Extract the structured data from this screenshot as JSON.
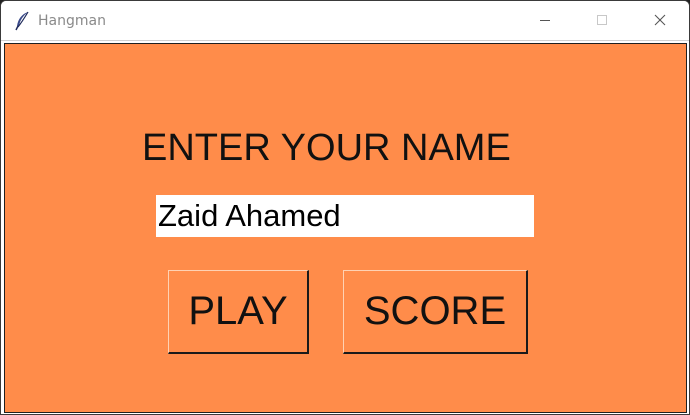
{
  "window": {
    "title": "Hangman",
    "icon": "feather-icon"
  },
  "form": {
    "heading": "ENTER YOUR NAME",
    "name_value": "Zaid Ahamed"
  },
  "buttons": {
    "play_label": "PLAY",
    "score_label": "SCORE"
  },
  "colors": {
    "background": "#ff8c4a",
    "input_background": "#ffffff",
    "text": "#111111"
  }
}
